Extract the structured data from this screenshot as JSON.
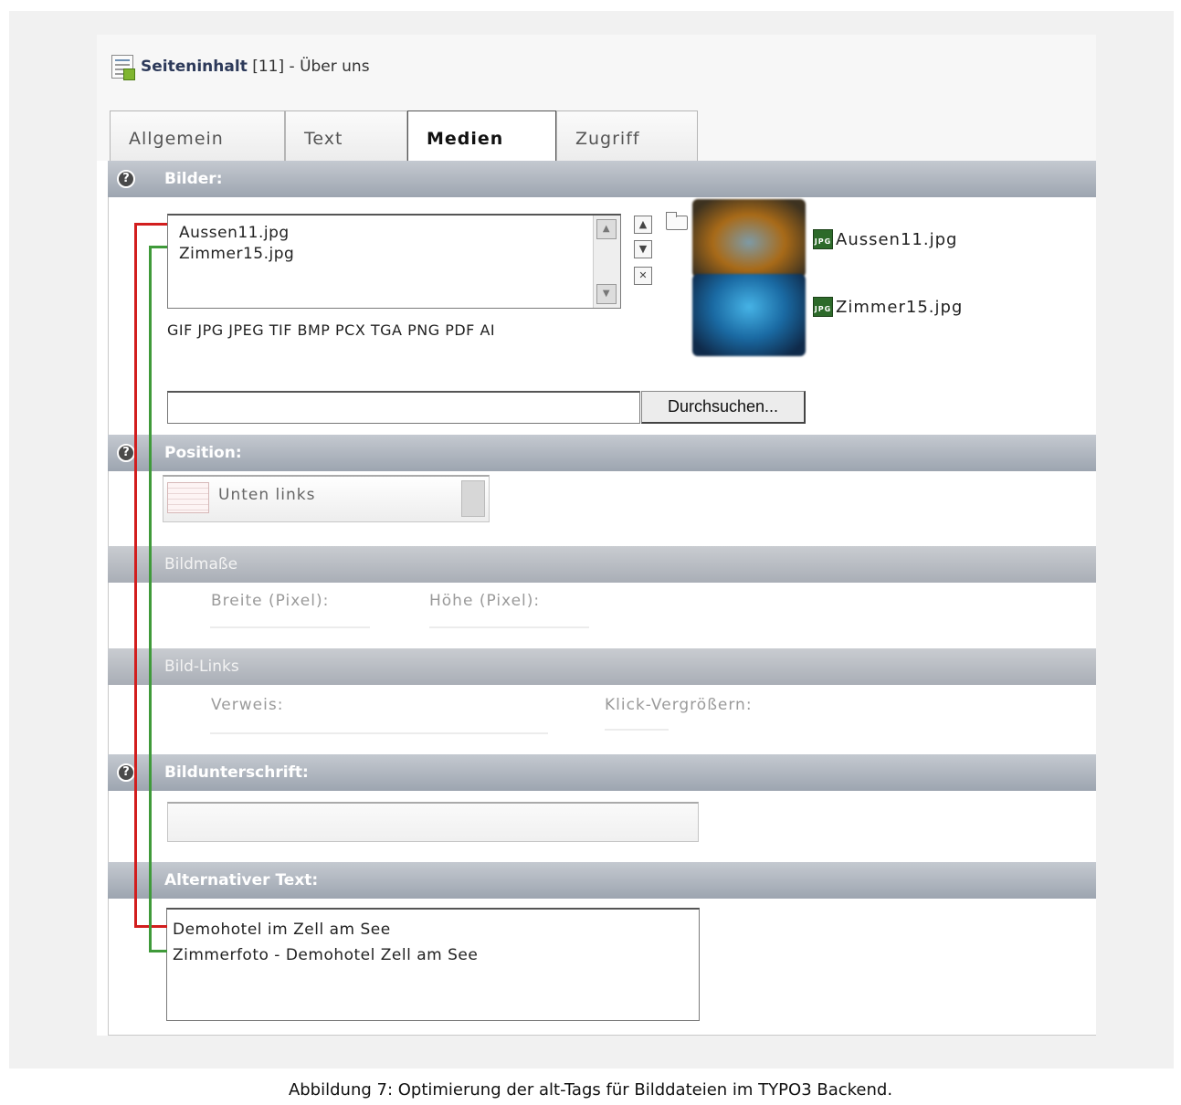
{
  "header": {
    "title_strong": "Seiteninhalt",
    "title_rest": " [11] - Über uns",
    "icon": "content-element-icon"
  },
  "tabs": [
    {
      "label": "Allgemein",
      "active": false
    },
    {
      "label": "Text",
      "active": false
    },
    {
      "label": "Medien",
      "active": true
    },
    {
      "label": "Zugriff",
      "active": false
    }
  ],
  "sections": {
    "images": {
      "title": "Bilder:",
      "files": [
        "Aussen11.jpg",
        "Zimmer15.jpg"
      ],
      "allowed_types": "GIF JPG JPEG TIF BMP PCX TGA PNG PDF AI",
      "thumbnail_files": [
        "Aussen11.jpg",
        "Zimmer15.jpg"
      ],
      "file_icon": "JPG",
      "upload_value": "",
      "browse_label": "Durchsuchen..."
    },
    "position": {
      "title": "Position:",
      "selected": "Unten links"
    },
    "dimensions": {
      "title": "Bildmaße",
      "width_label": "Breite (Pixel):",
      "height_label": "Höhe (Pixel):"
    },
    "links": {
      "title": "Bild-Links",
      "link_label": "Verweis:",
      "click_enlarge_label": "Klick-Vergrößern:"
    },
    "caption": {
      "title": "Bildunterschrift:",
      "value": ""
    },
    "alt_text": {
      "title": "Alternativer Text:",
      "lines": [
        "Demohotel im Zell am See",
        "Zimmerfoto - Demohotel Zell am See"
      ]
    }
  },
  "help_icon": "?",
  "figure_caption": "Abbildung 7: Optimierung der alt-Tags für Bilddateien im TYPO3 Backend.",
  "colors": {
    "connector_first": "#d21e1e",
    "connector_second": "#3f9a3a",
    "section_header": "#9da5b0"
  }
}
